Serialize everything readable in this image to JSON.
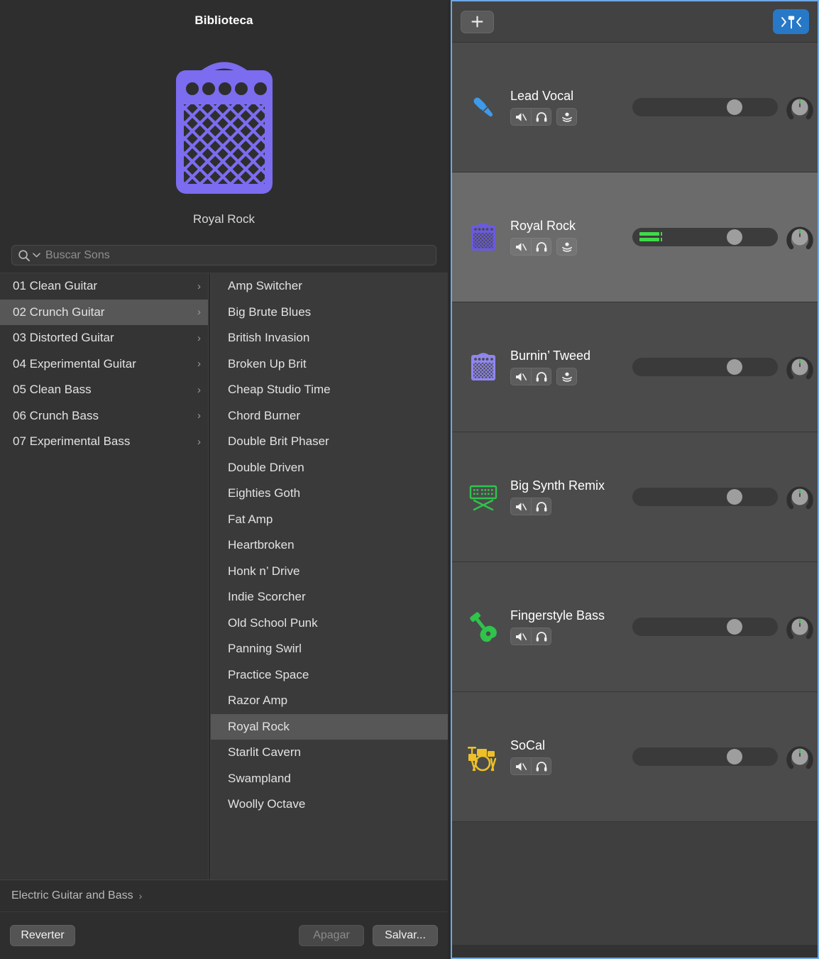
{
  "library": {
    "title": "Biblioteca",
    "preview": {
      "icon": "amp-icon",
      "name": "Royal Rock",
      "color": "#7b6cf0"
    },
    "search": {
      "placeholder": "Buscar Sons",
      "value": "",
      "icon": "search-icon"
    },
    "categories": [
      {
        "label": "01 Clean Guitar",
        "selected": false
      },
      {
        "label": "02 Crunch Guitar",
        "selected": true
      },
      {
        "label": "03 Distorted Guitar",
        "selected": false
      },
      {
        "label": "04 Experimental Guitar",
        "selected": false
      },
      {
        "label": "05 Clean Bass",
        "selected": false
      },
      {
        "label": "06 Crunch Bass",
        "selected": false
      },
      {
        "label": "07 Experimental Bass",
        "selected": false
      }
    ],
    "presets": [
      {
        "label": "Amp Switcher",
        "selected": false
      },
      {
        "label": "Big Brute Blues",
        "selected": false
      },
      {
        "label": "British Invasion",
        "selected": false
      },
      {
        "label": "Broken Up Brit",
        "selected": false
      },
      {
        "label": "Cheap Studio Time",
        "selected": false
      },
      {
        "label": "Chord Burner",
        "selected": false
      },
      {
        "label": "Double Brit Phaser",
        "selected": false
      },
      {
        "label": "Double Driven",
        "selected": false
      },
      {
        "label": "Eighties Goth",
        "selected": false
      },
      {
        "label": "Fat Amp",
        "selected": false
      },
      {
        "label": "Heartbroken",
        "selected": false
      },
      {
        "label": "Honk n’ Drive",
        "selected": false
      },
      {
        "label": "Indie Scorcher",
        "selected": false
      },
      {
        "label": "Old School Punk",
        "selected": false
      },
      {
        "label": "Panning Swirl",
        "selected": false
      },
      {
        "label": "Practice Space",
        "selected": false
      },
      {
        "label": "Razor Amp",
        "selected": false
      },
      {
        "label": "Royal Rock",
        "selected": true
      },
      {
        "label": "Starlit Cavern",
        "selected": false
      },
      {
        "label": "Swampland",
        "selected": false
      },
      {
        "label": "Woolly Octave",
        "selected": false
      }
    ],
    "breadcrumb": {
      "label": "Electric Guitar and Bass",
      "chevron": "›"
    },
    "buttons": {
      "revert": "Reverter",
      "delete": "Apagar",
      "save": "Salvar..."
    }
  },
  "tracks_panel": {
    "toolbar": {
      "add_label": "+",
      "add_icon": "plus-icon",
      "tuner_icon": "tuner-icon",
      "tuner_active_color": "#2878c8"
    },
    "tracks": [
      {
        "name": "Lead Vocal",
        "icon": "microphone-icon",
        "icon_color": "#3f9ae8",
        "selected": false,
        "buttons": [
          "mute-icon",
          "solo-icon",
          "input-monitor-icon"
        ],
        "has_input_monitor": true,
        "volume": 0.65,
        "pan": 0,
        "meter_active": false
      },
      {
        "name": "Royal Rock",
        "icon": "amp-icon",
        "icon_color": "#6a5ae0",
        "selected": true,
        "buttons": [
          "mute-icon",
          "solo-icon",
          "input-monitor-icon"
        ],
        "has_input_monitor": true,
        "volume": 0.65,
        "pan": 0,
        "meter_active": true
      },
      {
        "name": "Burnin’ Tweed",
        "icon": "amp-icon",
        "icon_color": "#8f86ef",
        "selected": false,
        "buttons": [
          "mute-icon",
          "solo-icon",
          "input-monitor-icon"
        ],
        "has_input_monitor": true,
        "volume": 0.65,
        "pan": 0,
        "meter_active": false
      },
      {
        "name": "Big Synth Remix",
        "icon": "synth-keyboard-icon",
        "icon_color": "#2fc44b",
        "selected": false,
        "buttons": [
          "mute-icon",
          "solo-icon"
        ],
        "has_input_monitor": false,
        "volume": 0.65,
        "pan": 0,
        "meter_active": false
      },
      {
        "name": "Fingerstyle Bass",
        "icon": "bass-guitar-icon",
        "icon_color": "#2fc44b",
        "selected": false,
        "buttons": [
          "mute-icon",
          "solo-icon"
        ],
        "has_input_monitor": false,
        "volume": 0.65,
        "pan": 0,
        "meter_active": false
      },
      {
        "name": "SoCal",
        "icon": "drum-kit-icon",
        "icon_color": "#edc028",
        "selected": false,
        "buttons": [
          "mute-icon",
          "solo-icon"
        ],
        "has_input_monitor": false,
        "volume": 0.65,
        "pan": 0,
        "meter_active": false
      }
    ]
  }
}
